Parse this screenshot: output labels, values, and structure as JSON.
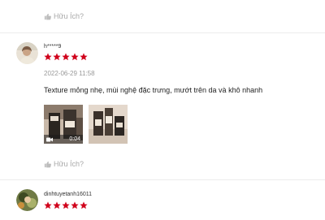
{
  "reviews": [
    {
      "username": "",
      "date": "",
      "content": "",
      "rating": 5,
      "helpful_label": "Hữu Ích?"
    },
    {
      "username": "h*****9",
      "date": "2022-06-29 11:58",
      "content": "Texture mỏng nhẹ, mùi nghệ đặc trưng, mướt trên da và khô nhanh",
      "rating": 5,
      "media": [
        {
          "type": "video",
          "duration": "0:04"
        },
        {
          "type": "image"
        }
      ],
      "helpful_label": "Hữu Ích?"
    },
    {
      "username": "dinhtuyetanh16011",
      "date": "",
      "rating": 5
    }
  ],
  "icons": {
    "thumb": "thumbs-up-icon",
    "star": "star-icon",
    "video": "video-camera-icon"
  },
  "colors": {
    "star": "#d0011b",
    "muted_text": "#a8a8a8",
    "divider": "#ececec"
  }
}
